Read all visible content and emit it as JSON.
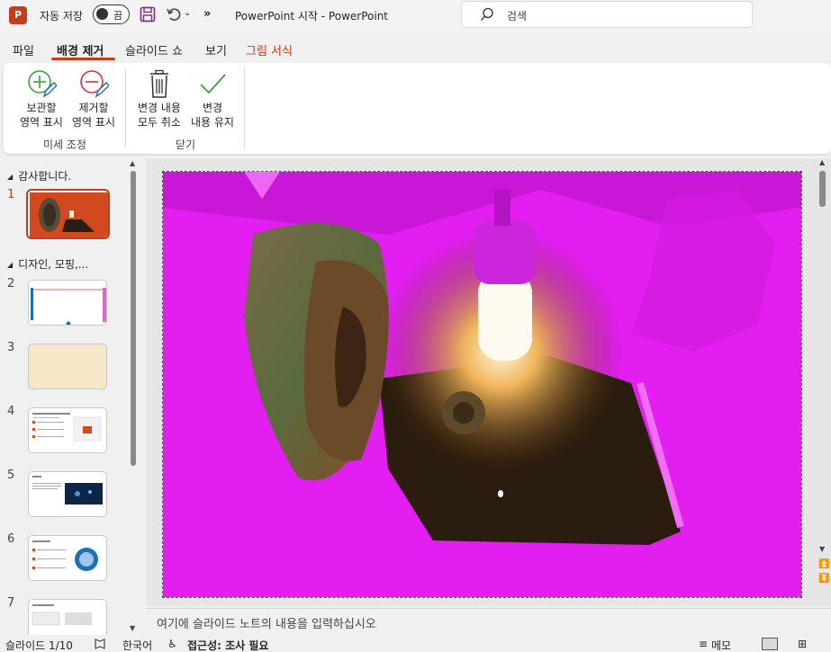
{
  "titlebar": {
    "app_logo": "P",
    "autosave_label": "자동 저장",
    "autosave_state": "끔",
    "doc_title": "PowerPoint 시작  -  PowerPoint",
    "more": "»",
    "search_placeholder": "검색"
  },
  "tabs": [
    {
      "label": "파일"
    },
    {
      "label": "배경 제거"
    },
    {
      "label": "슬라이드 쇼"
    },
    {
      "label": "보기"
    },
    {
      "label": "그림 서식"
    }
  ],
  "ribbon": {
    "mark_keep": {
      "line1": "보관할",
      "line2": "영역 표시"
    },
    "mark_remove": {
      "line1": "제거할",
      "line2": "영역 표시"
    },
    "group_refine": "미세 조정",
    "discard": {
      "line1": "변경 내용",
      "line2": "모두 취소"
    },
    "keep_changes": {
      "line1": "변경",
      "line2": "내용 유지"
    },
    "group_close": "닫기"
  },
  "thumbnails": {
    "section1": "감사합니다.",
    "section2": "디자인, 모핑,...",
    "slides": [
      {
        "number": "1"
      },
      {
        "number": "2"
      },
      {
        "number": "3"
      },
      {
        "number": "4"
      },
      {
        "number": "5"
      },
      {
        "number": "6"
      },
      {
        "number": "7"
      }
    ]
  },
  "notes": {
    "placeholder": "여기에 슬라이드 노트의 내용을 입력하십시오"
  },
  "status": {
    "slide_count": "슬라이드 1/10",
    "language": "한국어",
    "accessibility": "접근성: 조사 필요",
    "notes": "메모"
  },
  "colors": {
    "accent": "#c43e1c",
    "removal_mask": "#e21ef0"
  }
}
